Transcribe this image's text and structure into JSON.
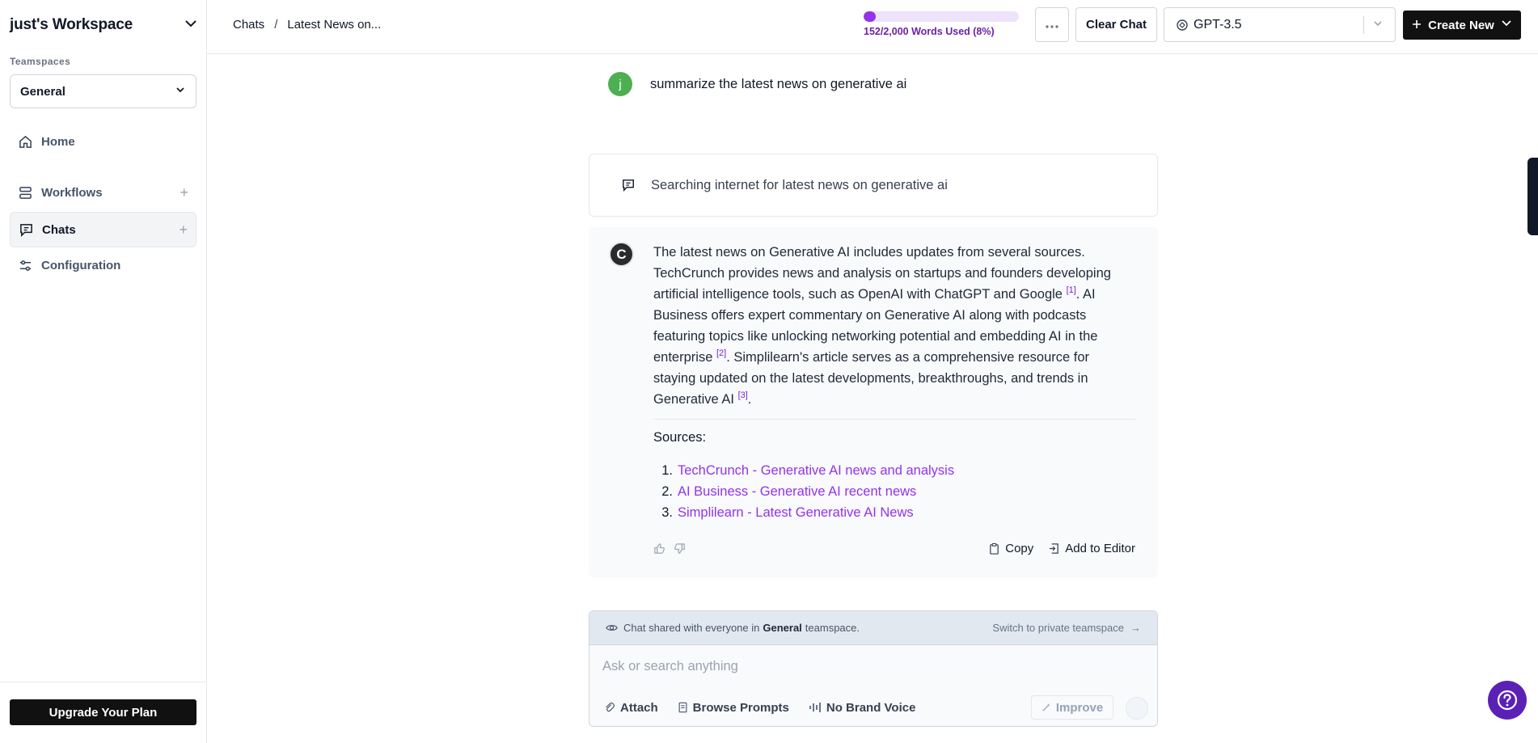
{
  "sidebar": {
    "workspace_title": "just's Workspace",
    "teamspaces_label": "Teamspaces",
    "teamspace_selected": "General",
    "nav": [
      {
        "label": "Home",
        "icon": "home-icon"
      },
      {
        "label": "Workflows",
        "icon": "workflows-icon"
      },
      {
        "label": "Chats",
        "icon": "chat-icon"
      },
      {
        "label": "Configuration",
        "icon": "sliders-icon"
      }
    ],
    "upgrade_label": "Upgrade Your Plan"
  },
  "header": {
    "breadcrumb": [
      "Chats",
      "Latest News on..."
    ],
    "usage_text": "152/2,000 Words Used (8%)",
    "usage_fraction": 0.076,
    "clear_chat_label": "Clear Chat",
    "model_selected": "GPT-3.5",
    "create_new_label": "Create New"
  },
  "chat": {
    "user_avatar_letter": "j",
    "user_message": "summarize the latest news on generative ai",
    "search_status": "Searching internet for latest news on generative ai",
    "assistant_avatar_letter": "C",
    "answer": {
      "part1": "The latest news on Generative AI includes updates from several sources. TechCrunch provides news and analysis on startups and founders developing artificial intelligence tools, such as OpenAI with ChatGPT and Google ",
      "cite1": "[1]",
      "part2": ". AI Business offers expert commentary on Generative AI along with podcasts featuring topics like unlocking networking potential and embedding AI in the enterprise ",
      "cite2": "[2]",
      "part3": ". Simplilearn's article serves as a comprehensive resource for staying updated on the latest developments, breakthroughs, and trends in Generative AI ",
      "cite3": "[3]",
      "part4": "."
    },
    "sources_title": "Sources:",
    "sources": [
      {
        "num": "1.",
        "label": "TechCrunch - Generative AI news and analysis"
      },
      {
        "num": "2.",
        "label": "AI Business - Generative AI recent news"
      },
      {
        "num": "3.",
        "label": "Simplilearn - Latest Generative AI News"
      }
    ],
    "copy_label": "Copy",
    "add_to_editor_label": "Add to Editor"
  },
  "composer": {
    "share_prefix": "Chat shared with everyone in",
    "share_teamspace": "General",
    "share_suffix": "teamspace.",
    "switch_label": "Switch to private teamspace",
    "placeholder": "Ask or search anything",
    "attach_label": "Attach",
    "browse_prompts_label": "Browse Prompts",
    "brand_voice_label": "No Brand Voice",
    "improve_label": "Improve"
  },
  "colors": {
    "accent": "#9333ea",
    "brand_dark": "#111111",
    "help_button": "#5b21b6",
    "user_avatar": "#4caf50"
  }
}
